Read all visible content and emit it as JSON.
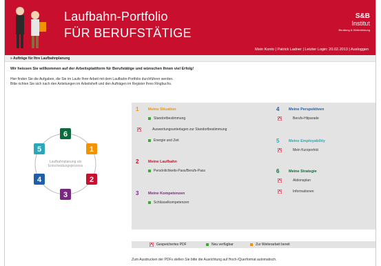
{
  "header": {
    "title_line1": "Laufbahn-Portfolio",
    "title_line2": "FÜR BERUFSTÄTIGE",
    "brand": "S&B",
    "brand_sub": "Institut",
    "brand_tagline": "Beratung & Weiterbildung",
    "bg_color": "#c8102e"
  },
  "usernav": {
    "konto": "Mein Konto",
    "sep1": " | ",
    "user": "Patrick Ladner",
    "sep2": " | ",
    "login": "Letzter Login: 20.02.2013",
    "sep3": " | ",
    "logout": "Ausloggen"
  },
  "breadcrumb": "» Aufträge für Ihre Laufbahnplanung",
  "welcome": "Wir heissen Sie willkommen auf der Arbeitsplattform für Berufstätige und wünschen Ihnen viel Erfolg!",
  "intro": [
    "Hier finden Sie die Aufgaben, die Sie im Laufe Ihrer Arbeit mit dem Laufbahn-Portfolio durchführen werden.",
    "Bitte richten Sie sich nach den Anleitungen im Arbeitsheft und den Aufträgen im Register Ihres Ringbuchs."
  ],
  "cycle": {
    "center_line1": "Laufbahnplanung als",
    "center_line2": "Entscheidungsprozess",
    "steps": [
      {
        "label": "1",
        "color": "#f39200"
      },
      {
        "label": "2",
        "color": "#c8102e"
      },
      {
        "label": "3",
        "color": "#7b2682"
      },
      {
        "label": "4",
        "color": "#1d5fa8"
      },
      {
        "label": "5",
        "color": "#2aa7b8"
      },
      {
        "label": "6",
        "color": "#0b6b3a"
      }
    ]
  },
  "sections": [
    {
      "num": "1",
      "title": "Meine Situation",
      "color": "#f39200",
      "items": [
        {
          "label": "Standortbestimmung",
          "icon": "green-square-icon"
        },
        {
          "label": "Auswertungsunterlagen zur Standortbestimmung",
          "icon": "pdf-icon"
        },
        {
          "label": "Energie und Zeit",
          "icon": "green-square-icon"
        }
      ]
    },
    {
      "num": "2",
      "title": "Meine Laufbahn",
      "color": "#c8102e",
      "items": [
        {
          "label": "Persönlichkeits-Pass/Berufs-Pass",
          "icon": "green-square-icon"
        }
      ]
    },
    {
      "num": "3",
      "title": "Meine Kompetenzen",
      "color": "#7b2682",
      "items": [
        {
          "label": "Schlüsselkompetenzen",
          "icon": "green-square-icon"
        }
      ]
    },
    {
      "num": "4",
      "title": "Meine Perspektiven",
      "color": "#1d5fa8",
      "items": [
        {
          "label": "Berufs-Hitparade",
          "icon": "pdf-icon"
        }
      ]
    },
    {
      "num": "5",
      "title": "Meine Employability",
      "color": "#2aa7b8",
      "items": [
        {
          "label": "Mein Kurzporträt",
          "icon": "pdf-icon"
        }
      ]
    },
    {
      "num": "6",
      "title": "Meine Strategie",
      "color": "#0b6b3a",
      "items": [
        {
          "label": "Aktionsplan",
          "icon": "pdf-icon"
        },
        {
          "label": "Informationen",
          "icon": "pdf-icon"
        }
      ]
    }
  ],
  "legend": {
    "pdf": "Gespeichertes PDF",
    "new": "Neu verfügbar",
    "ready": "Zur Weiterarbeit bereit"
  },
  "footer": "Zum Ausdrucken der PDFs stellen Sie bitte die Ausrichtung auf Hoch-/Querformat automatisch."
}
